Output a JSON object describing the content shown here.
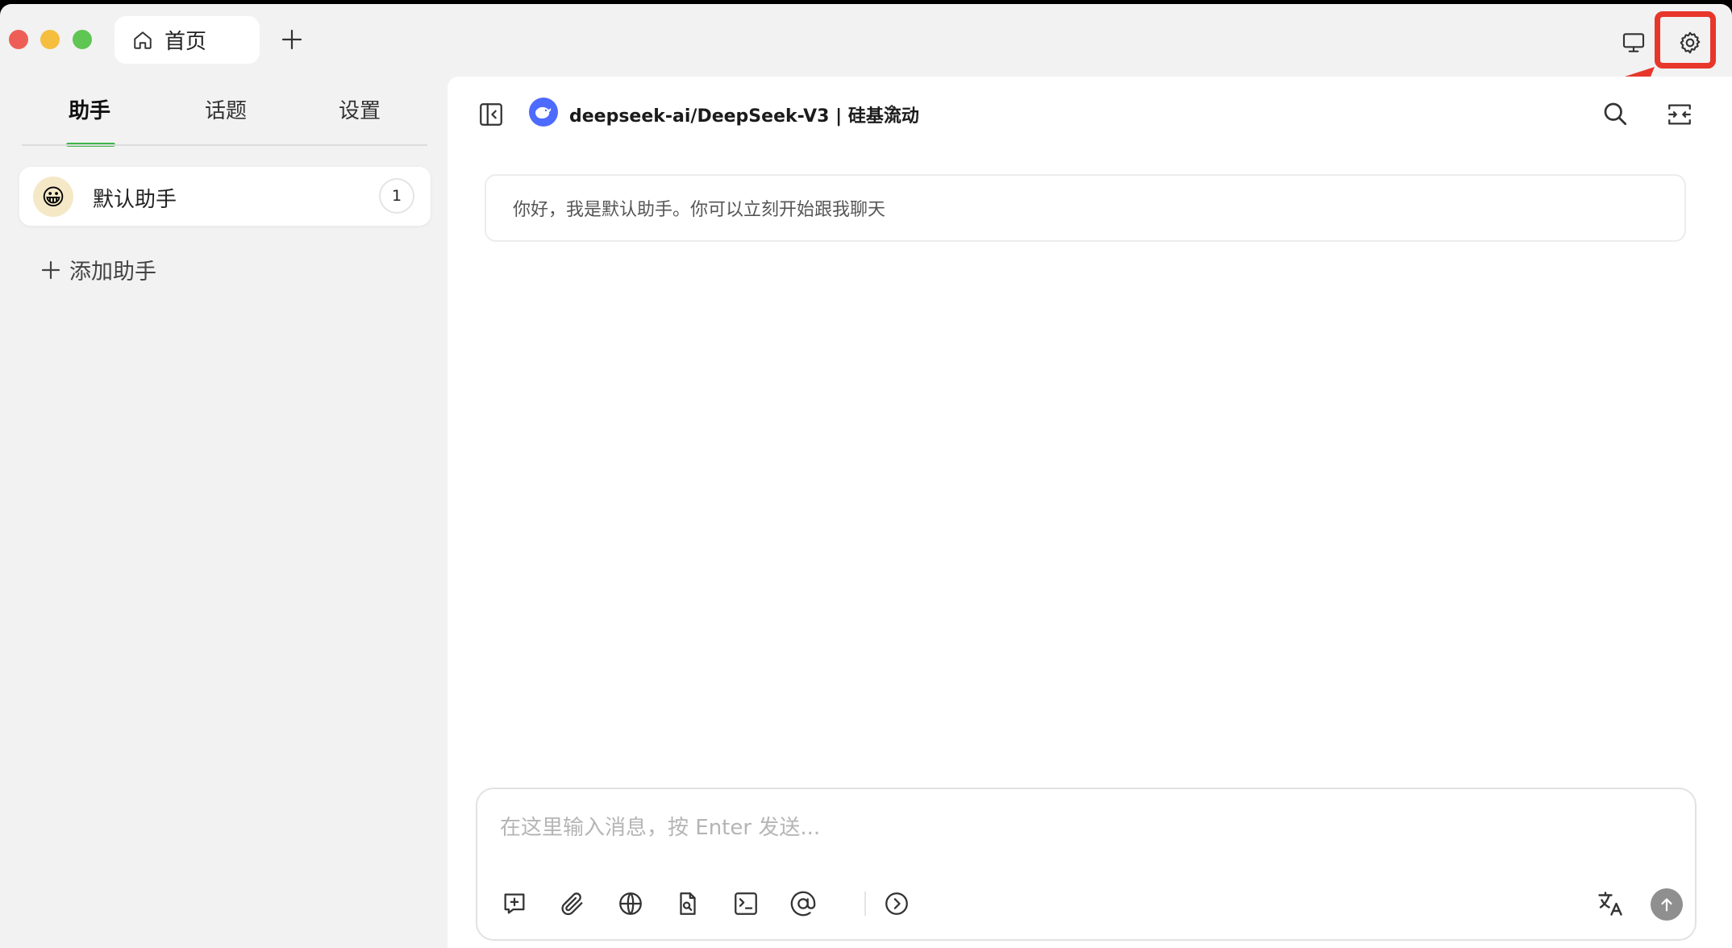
{
  "window": {
    "traffic_lights": [
      "close",
      "minimize",
      "maximize"
    ],
    "tab": {
      "icon": "home-icon",
      "label": "首页"
    },
    "toolbar_icons": [
      "plus-icon",
      "monitor-icon",
      "gear-icon"
    ]
  },
  "sidebar": {
    "tabs": [
      {
        "label": "助手",
        "active": true
      },
      {
        "label": "话题",
        "active": false
      },
      {
        "label": "设置",
        "active": false
      }
    ],
    "assistants": [
      {
        "avatar": "😀",
        "name": "默认助手",
        "count": "1"
      }
    ],
    "add_label": "添加助手"
  },
  "chat": {
    "model_name": "deepseek-ai/DeepSeek-V3 | 硅基流动",
    "greeting": "你好，我是默认助手。你可以立刻开始跟我聊天",
    "input_placeholder": "在这里输入消息，按 Enter 发送...",
    "tools": [
      "new-topic-icon",
      "attachment-icon",
      "web-search-icon",
      "knowledge-base-icon",
      "quick-phrase-icon",
      "mention-model-icon",
      "expand-icon"
    ],
    "right_tools": [
      "translate-icon",
      "send-icon"
    ]
  },
  "colors": {
    "accent_green": "#3cb44a",
    "highlight_red": "#e8362b",
    "deepseek_blue": "#4d6bfe"
  }
}
